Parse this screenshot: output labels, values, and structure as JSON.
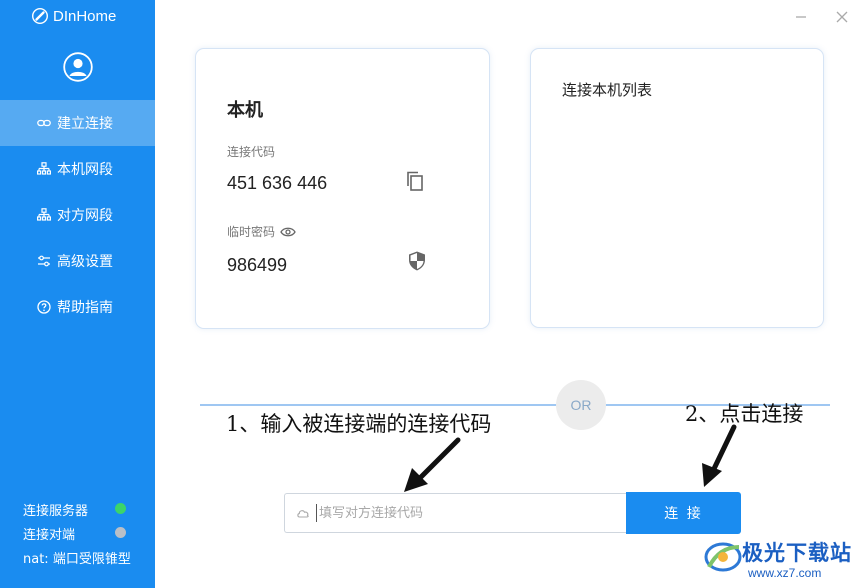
{
  "app": {
    "title": "DInHome"
  },
  "nav": {
    "items": [
      {
        "label": "建立连接",
        "icon": "link-icon",
        "active": true
      },
      {
        "label": "本机网段",
        "icon": "network-icon",
        "active": false
      },
      {
        "label": "对方网段",
        "icon": "network-icon",
        "active": false
      },
      {
        "label": "高级设置",
        "icon": "sliders-icon",
        "active": false
      },
      {
        "label": "帮助指南",
        "icon": "help-icon",
        "active": false
      }
    ]
  },
  "status": {
    "server_label": "连接服务器",
    "server_color": "#3cd46a",
    "peer_label": "连接对端",
    "peer_color": "#b9bfc7",
    "nat_label": "nat: 端口受限锥型"
  },
  "local": {
    "title": "本机",
    "code_label": "连接代码",
    "code_value": "451 636 446",
    "password_label": "临时密码",
    "password_value": "986499"
  },
  "list": {
    "title": "连接本机列表"
  },
  "divider": {
    "or_label": "OR"
  },
  "connect": {
    "placeholder": "填写对方连接代码",
    "button_label": "连 接"
  },
  "annotations": {
    "step1": "1、输入被连接端的连接代码",
    "step2": "2、点击连接"
  },
  "watermark": {
    "brand": "极光下载站",
    "url": "www.xz7.com"
  },
  "colors": {
    "accent": "#1a8cf0",
    "active_nav": "#56aaf2"
  }
}
